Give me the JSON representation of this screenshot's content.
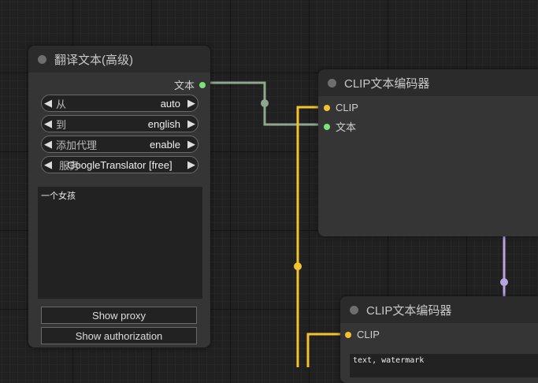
{
  "translate_node": {
    "title": "翻译文本(高级)",
    "output_label": "文本",
    "widgets": [
      {
        "label": "从",
        "value": "auto"
      },
      {
        "label": "到",
        "value": "english"
      },
      {
        "label": "添加代理",
        "value": "enable"
      },
      {
        "label": "服务",
        "value": "GoogleTranslator [free]"
      }
    ],
    "text": "一个女孩",
    "show_proxy_label": "Show proxy",
    "show_authorization_label": "Show authorization"
  },
  "clip_node_1": {
    "title": "CLIP文本编码器",
    "inputs": [
      "CLIP",
      "文本"
    ]
  },
  "clip_node_2": {
    "title": "CLIP文本编码器",
    "inputs": [
      "CLIP"
    ],
    "text": "text, watermark"
  },
  "colors": {
    "clip_wire": "#f4c230",
    "text_wire": "#8fa78f",
    "conditioning_wire": "#b9a4e0"
  }
}
